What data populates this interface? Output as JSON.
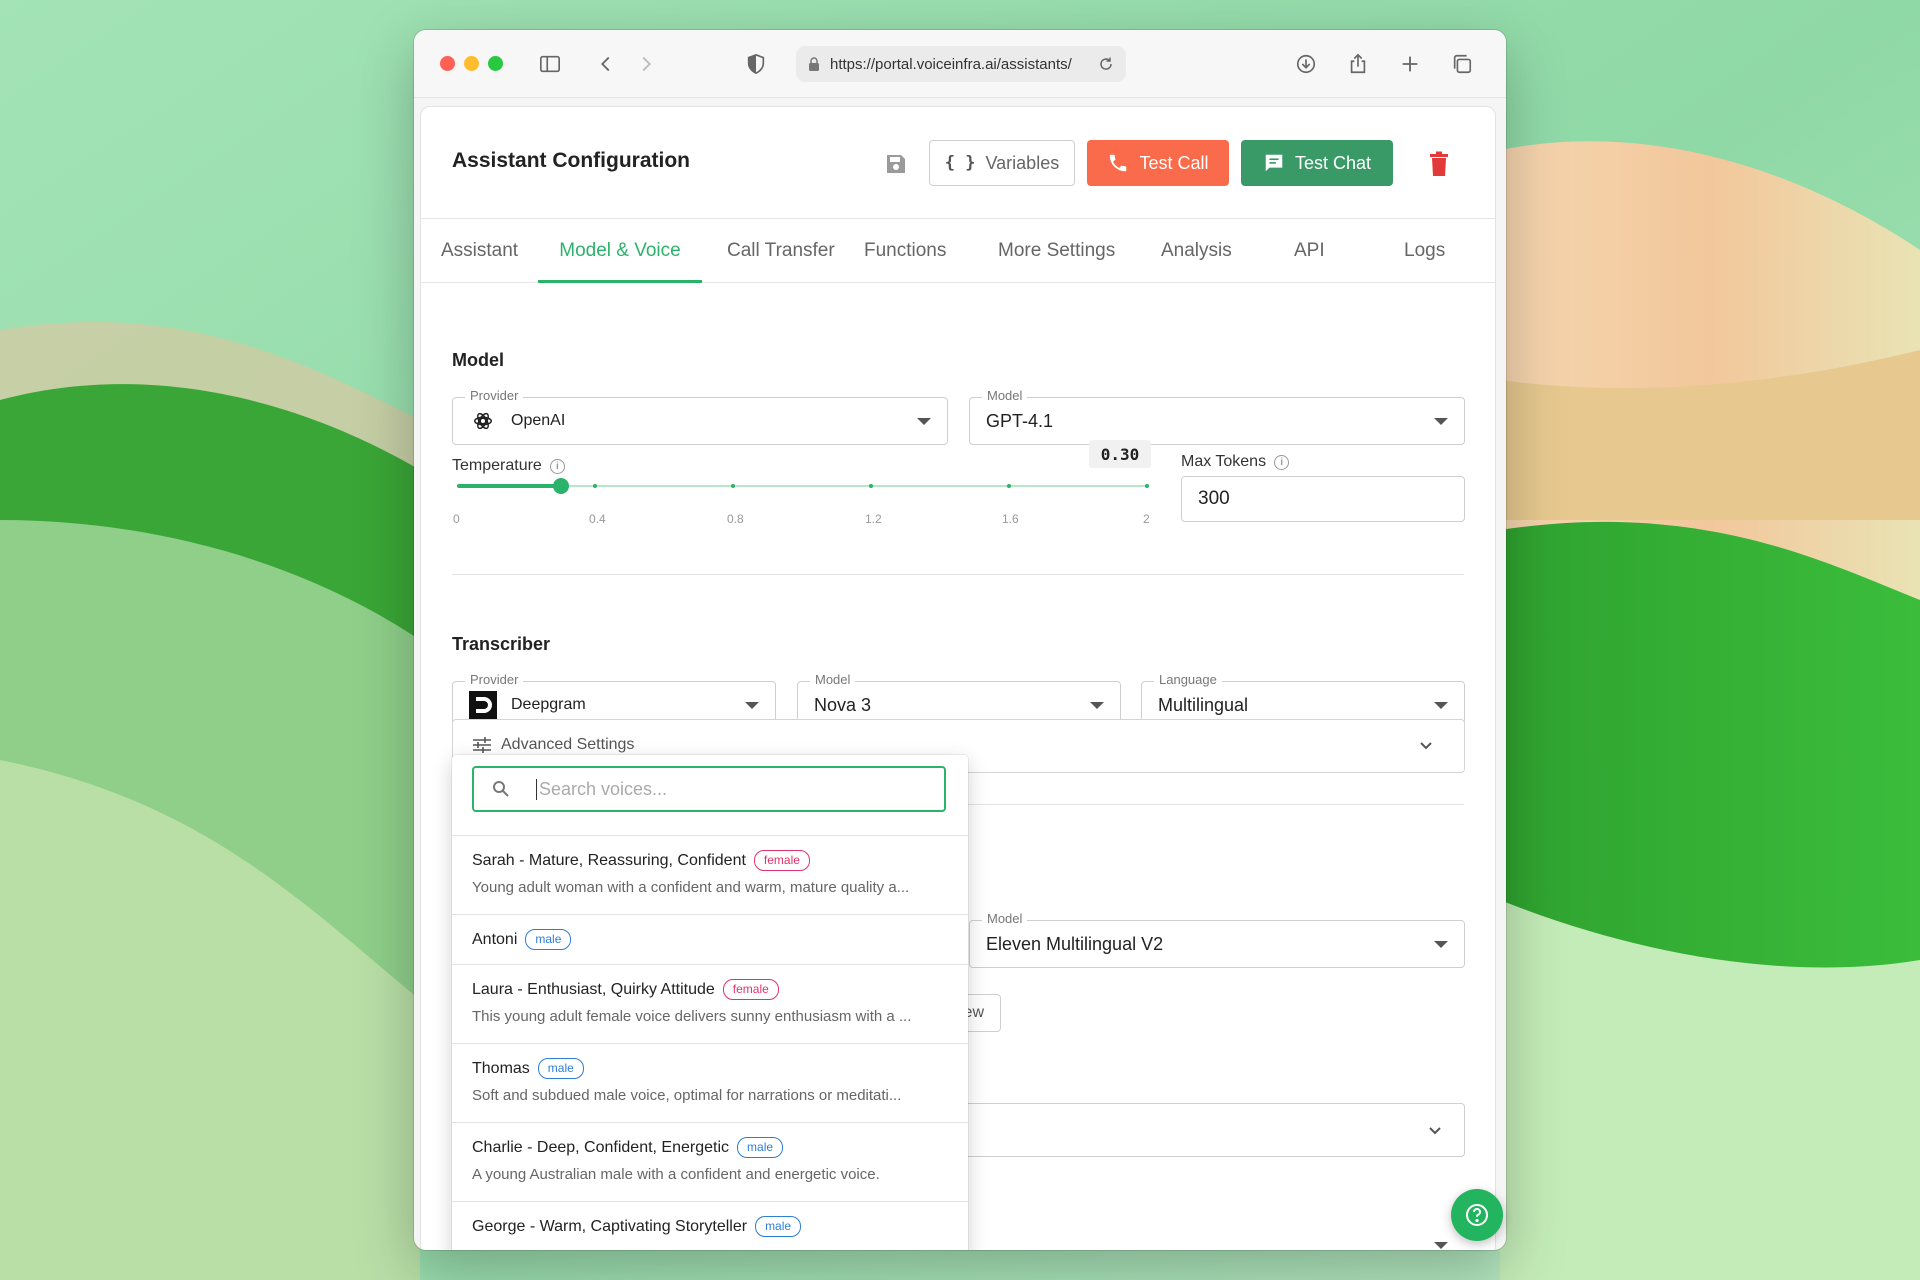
{
  "browser": {
    "url": "https://portal.voiceinfra.ai/assistants/"
  },
  "header": {
    "title": "Assistant Configuration",
    "variables_label": "Variables",
    "test_call_label": "Test Call",
    "test_chat_label": "Test Chat"
  },
  "tabs": [
    "Assistant",
    "Model & Voice",
    "Call Transfer",
    "Functions",
    "More Settings",
    "Analysis",
    "API",
    "Logs"
  ],
  "active_tab": "Model & Voice",
  "model_section": {
    "title": "Model",
    "provider_label": "Provider",
    "provider_value": "OpenAI",
    "model_label": "Model",
    "model_value": "GPT-4.1",
    "temperature_label": "Temperature",
    "temperature_value": "0.30",
    "temperature_fraction": 0.15,
    "temperature_ticks": [
      "0",
      "0.4",
      "0.8",
      "1.2",
      "1.6",
      "2"
    ],
    "max_tokens_label": "Max Tokens",
    "max_tokens_value": "300"
  },
  "transcriber_section": {
    "title": "Transcriber",
    "provider_label": "Provider",
    "provider_value": "Deepgram",
    "model_label": "Model",
    "model_value": "Nova 3",
    "language_label": "Language",
    "language_value": "Multilingual",
    "advanced_label": "Advanced Settings"
  },
  "voice_section": {
    "model_label": "Model",
    "model_value": "Eleven Multilingual V2",
    "preview_fragment": "ew"
  },
  "voice_dropdown": {
    "search_placeholder": "Search voices...",
    "items": [
      {
        "name": "Sarah - Mature, Reassuring, Confident",
        "gender": "female",
        "desc": "Young adult woman with a confident and warm, mature quality a..."
      },
      {
        "name": "Antoni",
        "gender": "male",
        "desc": ""
      },
      {
        "name": "Laura - Enthusiast, Quirky Attitude",
        "gender": "female",
        "desc": "This young adult female voice delivers sunny enthusiasm with a ..."
      },
      {
        "name": "Thomas",
        "gender": "male",
        "desc": "Soft and subdued male voice, optimal for narrations or meditati..."
      },
      {
        "name": "Charlie - Deep, Confident, Energetic",
        "gender": "male",
        "desc": "A young Australian male with a confident and energetic voice."
      },
      {
        "name": "George - Warm, Captivating Storyteller",
        "gender": "male",
        "desc": ""
      }
    ]
  },
  "colors": {
    "accent": "#2bb36b",
    "test_call": "#f96b4a",
    "test_chat": "#3a9a67",
    "delete": "#e23a3a"
  }
}
